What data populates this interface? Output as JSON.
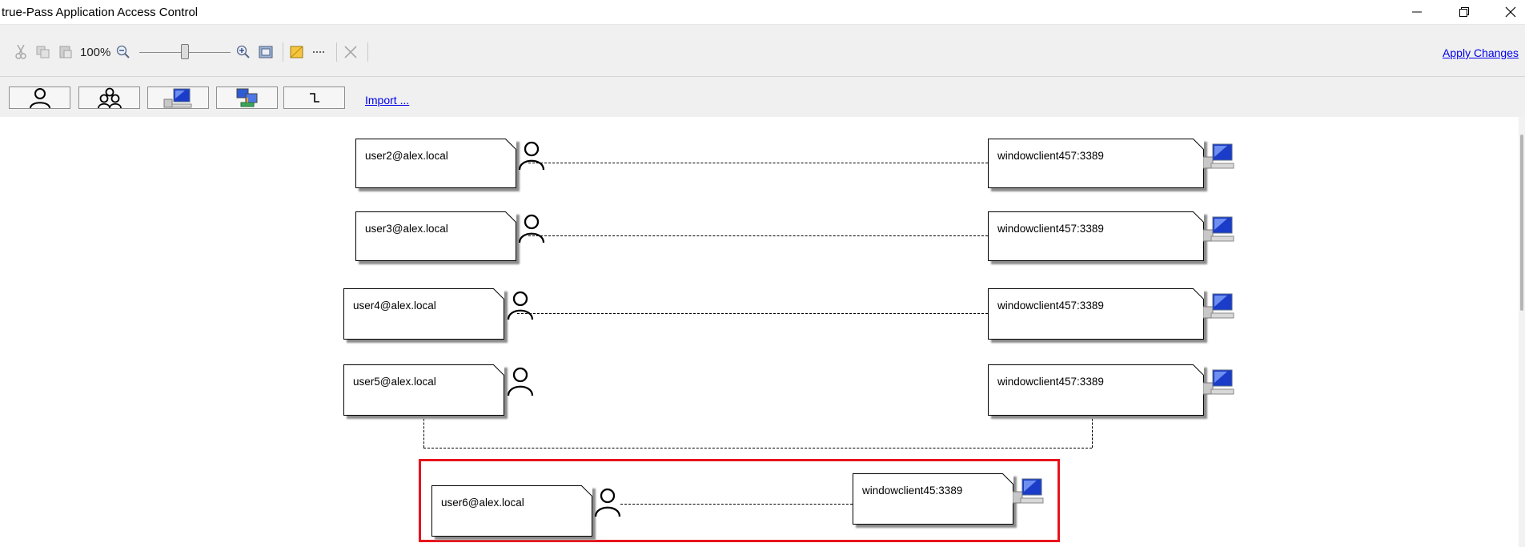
{
  "window": {
    "title": "true-Pass Application Access Control",
    "minimize_icon": "minimize-icon",
    "restore_icon": "restore-icon",
    "close_icon": "close-icon"
  },
  "toolbar": {
    "zoom_level": "100%",
    "zoom_slider_fraction": 0.45,
    "apply_label": "Apply Changes",
    "icons": [
      "cut-icon",
      "copy-icon",
      "paste-icon",
      "zoom-out-icon",
      "zoom-in-icon",
      "fit-to-window-icon",
      "note-icon",
      "dash-line-icon",
      "delete-icon"
    ]
  },
  "shapebar": {
    "buttons": [
      "user-icon",
      "group-icon",
      "computer-icon",
      "network-icon",
      "connector-icon"
    ],
    "import_label": "Import ..."
  },
  "diagram": {
    "rules": [
      {
        "user": "user2@alex.local",
        "target": "windowclient457:3389"
      },
      {
        "user": "user3@alex.local",
        "target": "windowclient457:3389"
      },
      {
        "user": "user4@alex.local",
        "target": "windowclient457:3389"
      },
      {
        "user": "user5@alex.local",
        "target": "windowclient457:3389"
      },
      {
        "user": "user6@alex.local",
        "target": "windowclient45:3389"
      }
    ],
    "highlight_color": "#e8141c"
  }
}
